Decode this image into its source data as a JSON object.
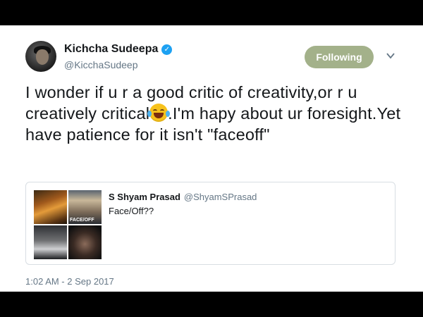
{
  "author": {
    "name": "Kichcha Sudeepa",
    "handle": "@KicchaSudeep",
    "verified_icon": "verified-badge-icon"
  },
  "follow_button": {
    "label": "Following",
    "color": "#a3b18a"
  },
  "tweet": {
    "text_before_emoji": "I wonder if u r a good critic of creativity,or r u creatively critical",
    "emoji": "face-with-tears-of-joy",
    "text_after_emoji": ".I'm hapy about ur foresight.Yet have patience for it isn't \"faceoff\""
  },
  "quoted_tweet": {
    "name": "S Shyam Prasad",
    "handle": "@ShyamSPrasad",
    "text": "Face/Off??",
    "media": [
      "movie-poster-1",
      "face-off-poster",
      "movie-poster-3",
      "man-covering-face-photo"
    ]
  },
  "timestamp": "1:02 AM - 2 Sep 2017",
  "colors": {
    "verified": "#1da1f2",
    "secondary_text": "#657786",
    "primary_text": "#14171a",
    "border": "#d8dee3"
  }
}
